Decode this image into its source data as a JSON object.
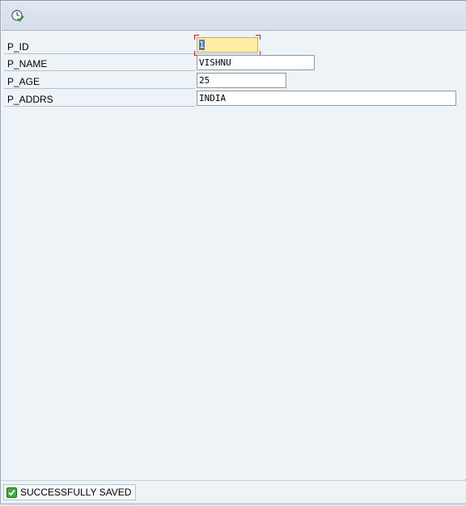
{
  "toolbar": {
    "execute_icon": "execute-clock-check-icon"
  },
  "form": {
    "fields": [
      {
        "label": "P_ID",
        "value": "1",
        "focused": true
      },
      {
        "label": "P_NAME",
        "value": "VISHNU",
        "focused": false
      },
      {
        "label": "P_AGE",
        "value": "25",
        "focused": false
      },
      {
        "label": "P_ADDRS",
        "value": "INDIA",
        "focused": false
      }
    ]
  },
  "status": {
    "icon": "success-check-icon",
    "message": "SUCCESSFULLY SAVED"
  },
  "colors": {
    "focused_field": "#ffeea6",
    "success": "#2e9a2e"
  }
}
